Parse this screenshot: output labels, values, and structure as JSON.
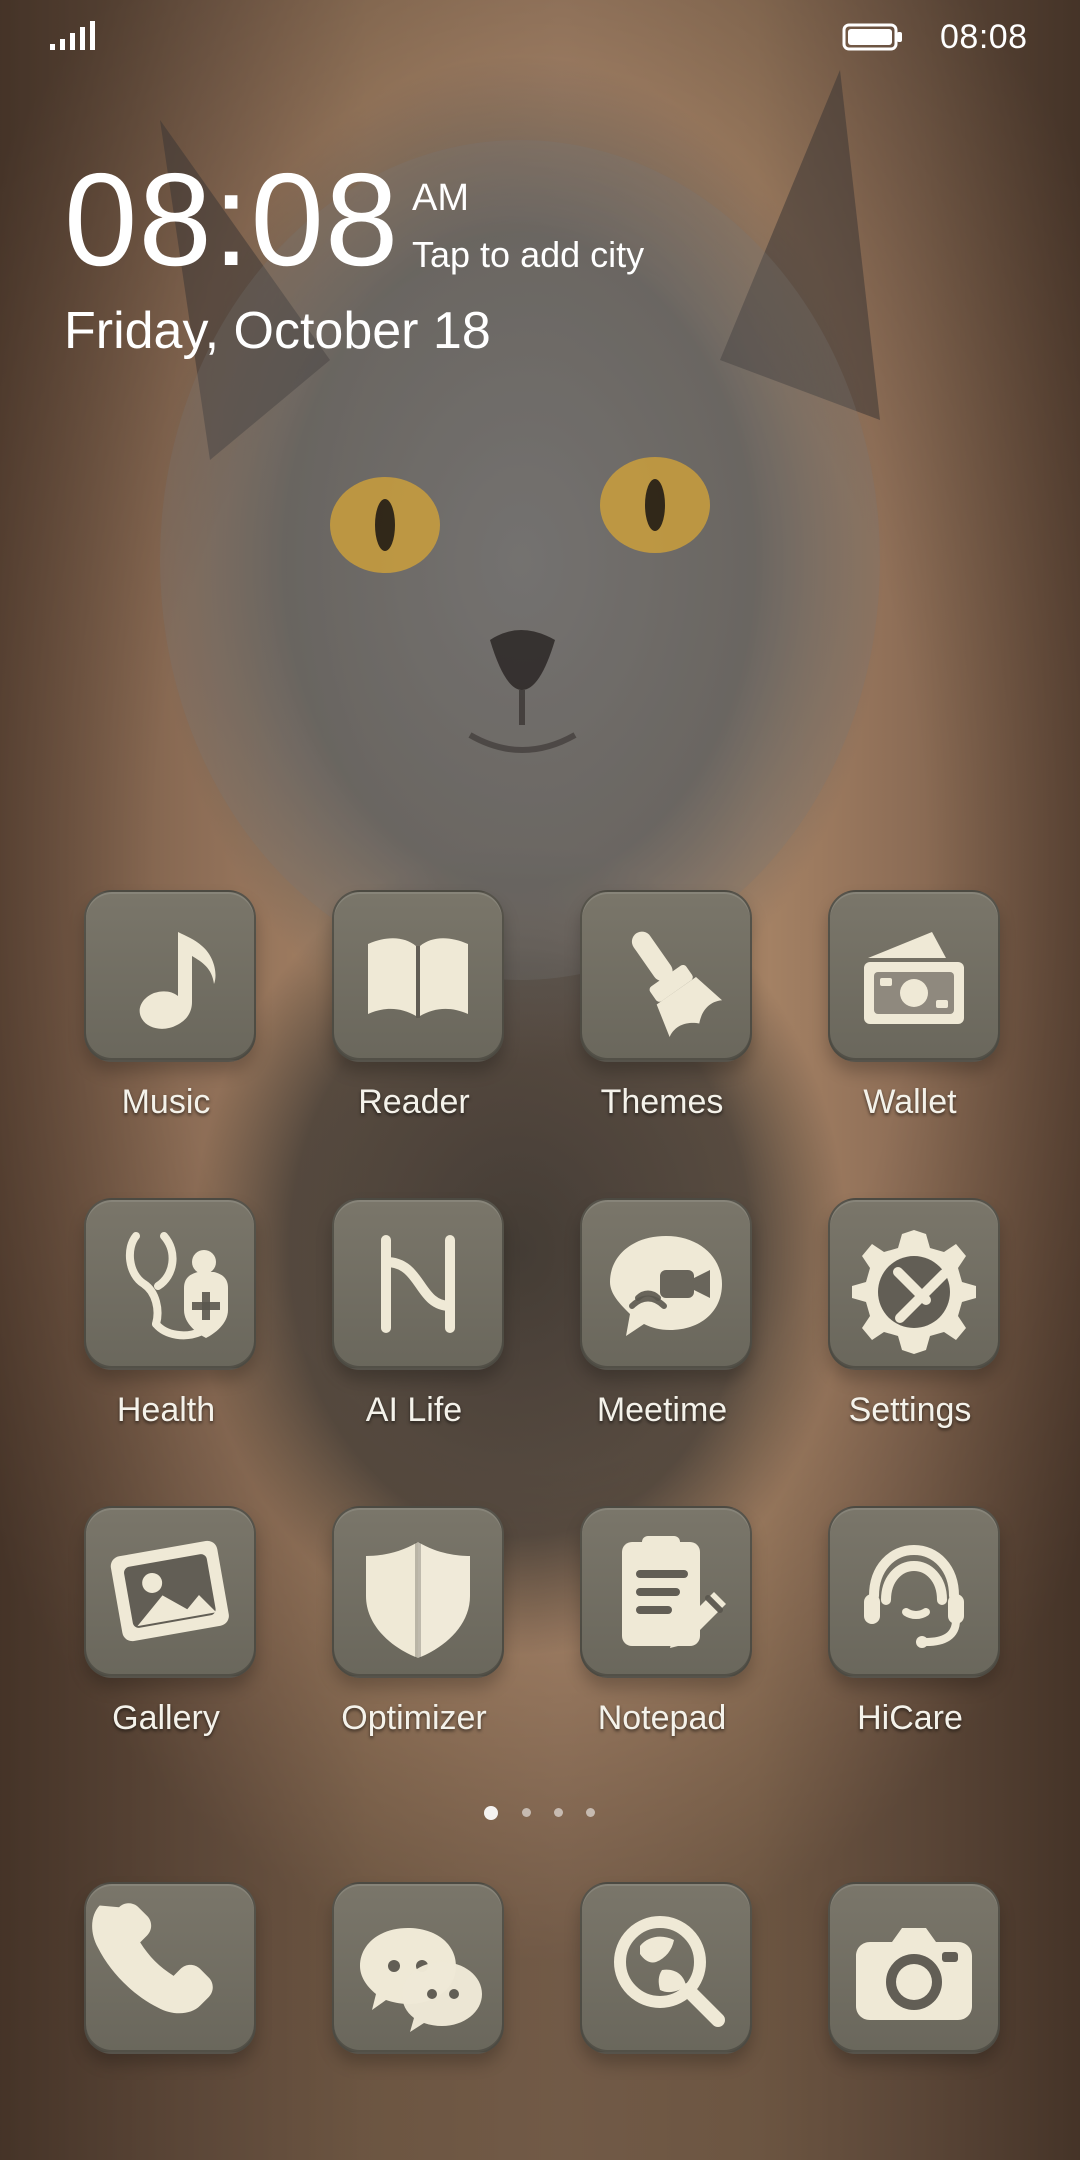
{
  "status_bar": {
    "time": "08:08",
    "icons": {
      "signal": "signal-icon",
      "battery": "battery-icon"
    }
  },
  "clock_widget": {
    "time": "08:08",
    "ampm": "AM",
    "city_prompt": "Tap to add city",
    "date": "Friday, October 18"
  },
  "apps": [
    {
      "label": "Music",
      "icon": "music-note-icon"
    },
    {
      "label": "Reader",
      "icon": "book-icon"
    },
    {
      "label": "Themes",
      "icon": "paintbrush-icon"
    },
    {
      "label": "Wallet",
      "icon": "wallet-icon"
    },
    {
      "label": "Health",
      "icon": "stethoscope-icon"
    },
    {
      "label": "AI Life",
      "icon": "ai-life-icon"
    },
    {
      "label": "Meetime",
      "icon": "meetime-icon"
    },
    {
      "label": "Settings",
      "icon": "gear-tools-icon"
    },
    {
      "label": "Gallery",
      "icon": "gallery-icon"
    },
    {
      "label": "Optimizer",
      "icon": "shield-icon"
    },
    {
      "label": "Notepad",
      "icon": "notepad-icon"
    },
    {
      "label": "HiCare",
      "icon": "support-agent-icon"
    }
  ],
  "page_indicator": {
    "pages": 4,
    "active_index": 0
  },
  "dock": [
    {
      "name": "Phone",
      "icon": "phone-icon"
    },
    {
      "name": "Messaging",
      "icon": "chat-bubbles-icon"
    },
    {
      "name": "Browser",
      "icon": "globe-search-icon"
    },
    {
      "name": "Camera",
      "icon": "camera-icon"
    }
  ],
  "colors": {
    "tile": "#6f6b60",
    "icon_fg": "#efe9d6",
    "text": "#ffffff"
  }
}
